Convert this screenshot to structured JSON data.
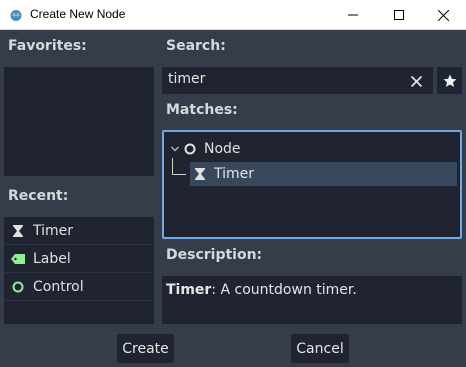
{
  "window": {
    "title": "Create New Node",
    "app_icon": "godot-icon"
  },
  "favorites": {
    "label": "Favorites:"
  },
  "recent": {
    "label": "Recent:",
    "items": [
      {
        "label": "Timer",
        "icon": "hourglass-icon"
      },
      {
        "label": "Label",
        "icon": "label-tag-icon",
        "icon_color": "#8eef97"
      },
      {
        "label": "Control",
        "icon": "circle-outline-icon",
        "icon_color": "#8eef97"
      }
    ]
  },
  "search": {
    "label": "Search:",
    "value": "timer"
  },
  "matches": {
    "label": "Matches:",
    "tree": [
      {
        "label": "Node",
        "icon": "circle-outline-icon",
        "expanded": true
      },
      {
        "label": "Timer",
        "icon": "hourglass-icon",
        "selected": true
      }
    ]
  },
  "description": {
    "label": "Description:",
    "name": "Timer",
    "text": ": A countdown timer."
  },
  "buttons": {
    "create": "Create",
    "cancel": "Cancel"
  },
  "colors": {
    "background": "#363d4a",
    "panel": "#1f2430",
    "selection": "#37475c",
    "focus_border": "#6ea9e8",
    "control_green": "#8eef97"
  }
}
